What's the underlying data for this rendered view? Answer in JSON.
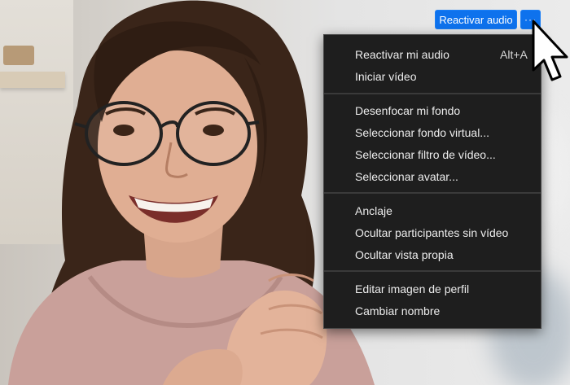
{
  "video": {
    "participant": "participant video"
  },
  "toolbar": {
    "reactivar_audio_label": "Reactivar audio",
    "more_label": "···"
  },
  "menu": {
    "items": [
      {
        "label": "Reactivar mi audio",
        "shortcut": "Alt+A"
      },
      {
        "label": "Iniciar vídeo",
        "shortcut": ""
      },
      {
        "label": "Desenfocar mi fondo",
        "shortcut": ""
      },
      {
        "label": "Seleccionar fondo virtual...",
        "shortcut": ""
      },
      {
        "label": "Seleccionar filtro de vídeo...",
        "shortcut": ""
      },
      {
        "label": "Seleccionar avatar...",
        "shortcut": ""
      },
      {
        "label": "Anclaje",
        "shortcut": ""
      },
      {
        "label": "Ocultar participantes sin vídeo",
        "shortcut": ""
      },
      {
        "label": "Ocultar vista propia",
        "shortcut": ""
      },
      {
        "label": "Editar imagen de perfil",
        "shortcut": ""
      },
      {
        "label": "Cambiar nombre",
        "shortcut": ""
      }
    ]
  },
  "colors": {
    "accent": "#0e72ed",
    "menu_bg": "#1e1e1e",
    "menu_text": "#ececec"
  }
}
